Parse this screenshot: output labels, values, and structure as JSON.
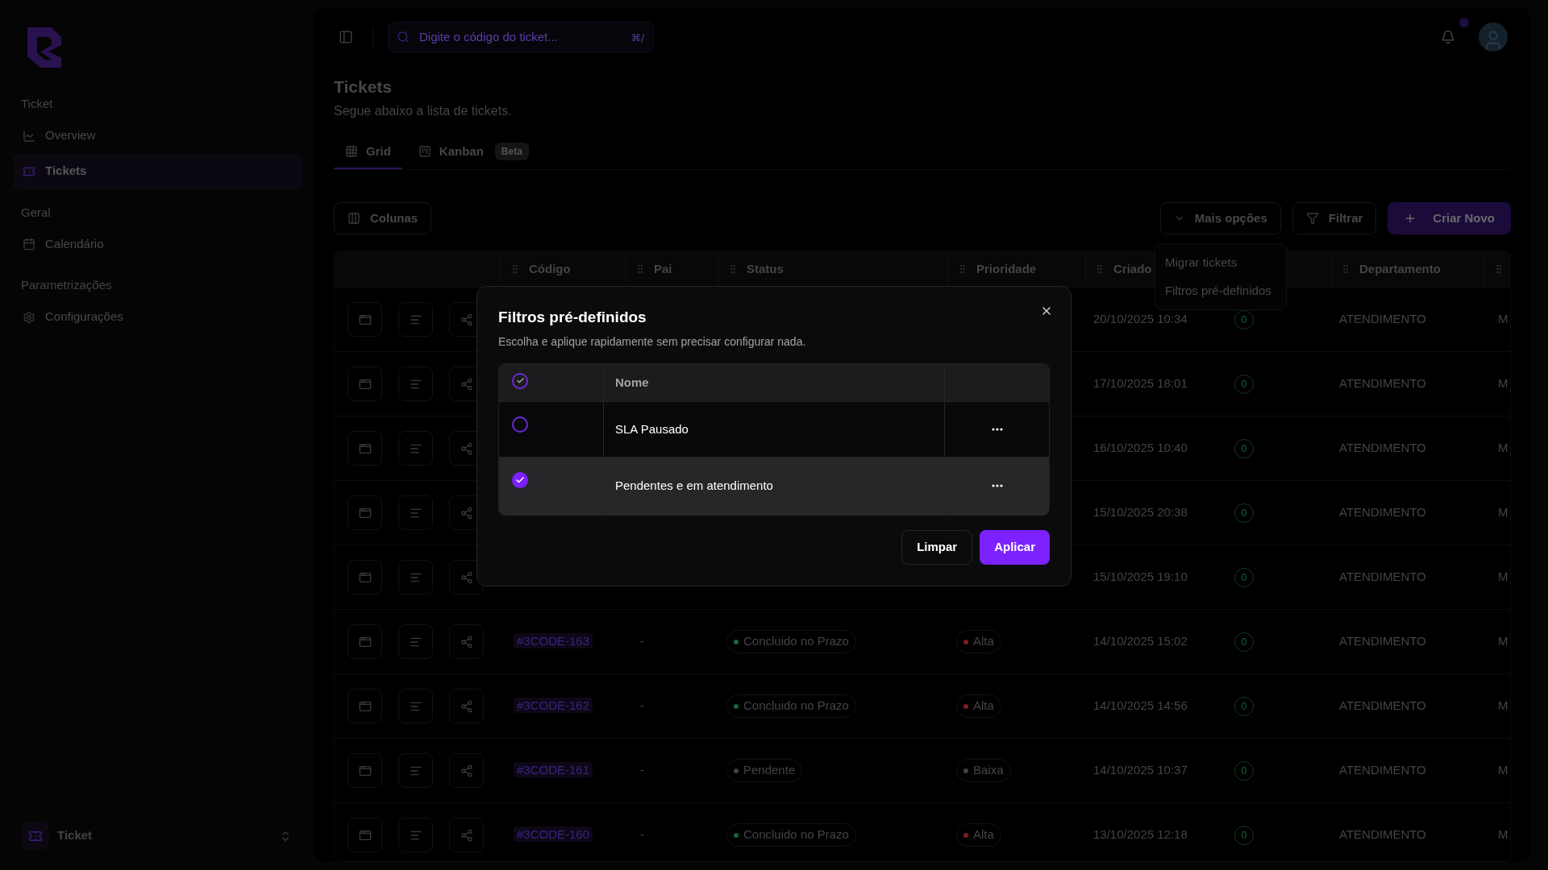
{
  "sidebar": {
    "sections": [
      {
        "title": "Ticket",
        "items": [
          {
            "label": "Overview",
            "selected": false
          },
          {
            "label": "Tickets",
            "selected": true
          }
        ]
      },
      {
        "title": "Geral",
        "items": [
          {
            "label": "Calendário",
            "selected": false
          }
        ]
      },
      {
        "title": "Parametrizações",
        "items": [
          {
            "label": "Configurações",
            "selected": false
          }
        ]
      }
    ],
    "workspace": {
      "name": "Ticket"
    }
  },
  "header": {
    "search": {
      "placeholder": "Digite o código do ticket...",
      "shortcut": "⌘/"
    }
  },
  "page": {
    "title": "Tickets",
    "subtitle": "Segue abaixo a lista de tickets."
  },
  "tabs": [
    {
      "label": "Grid",
      "selected": true
    },
    {
      "label": "Kanban",
      "badge": "Beta",
      "selected": false
    }
  ],
  "toolbar": {
    "columns_button": "Colunas",
    "more_button": "Mais opções",
    "filter_button": "Filtrar",
    "create_button": "Criar Novo"
  },
  "more_menu": [
    "Migrar tickets",
    "Filtros pré-definidos"
  ],
  "table": {
    "columns": [
      "Código",
      "Pai",
      "Status",
      "Prioridade",
      "Criado",
      "Departamento"
    ],
    "rows": [
      {
        "created": "20/10/2025 10:34",
        "count": "0",
        "department": "ATENDIMENTO",
        "column_9": "M"
      },
      {
        "created": "17/10/2025 18:01",
        "count": "0",
        "department": "ATENDIMENTO",
        "column_9": "M"
      },
      {
        "created": "16/10/2025 10:40",
        "count": "0",
        "department": "ATENDIMENTO",
        "column_9": "M"
      },
      {
        "created": "15/10/2025 20:38",
        "count": "0",
        "department": "ATENDIMENTO",
        "column_9": "M"
      },
      {
        "created": "15/10/2025 19:10",
        "count": "0",
        "department": "ATENDIMENTO",
        "column_9": "M"
      },
      {
        "code": "#3CODE-163",
        "parent": "-",
        "status": {
          "label": "Concluido no Prazo",
          "color": "#166534"
        },
        "priority": {
          "label": "Alta",
          "color": "#7f1d1d"
        },
        "created": "14/10/2025 15:02",
        "count": "0",
        "department": "ATENDIMENTO",
        "column_9": "M"
      },
      {
        "code": "#3CODE-162",
        "parent": "-",
        "status": {
          "label": "Concluido no Prazo",
          "color": "#166534"
        },
        "priority": {
          "label": "Alta",
          "color": "#7f1d1d"
        },
        "created": "14/10/2025 14:56",
        "count": "0",
        "department": "ATENDIMENTO",
        "column_9": "M"
      },
      {
        "code": "#3CODE-161",
        "parent": "-",
        "status": {
          "label": "Pendente",
          "color": "#404040"
        },
        "priority": {
          "label": "Baixa",
          "color": "#404040"
        },
        "created": "14/10/2025 10:37",
        "count": "0",
        "department": "ATENDIMENTO",
        "column_9": "M"
      },
      {
        "code": "#3CODE-160",
        "parent": "-",
        "status": {
          "label": "Concluido no Prazo",
          "color": "#166534"
        },
        "priority": {
          "label": "Alta",
          "color": "#7f1d1d"
        },
        "created": "13/10/2025 12:18",
        "count": "0",
        "department": "ATENDIMENTO",
        "column_9": "M"
      }
    ]
  },
  "modal": {
    "title": "Filtros pré-definidos",
    "subtitle": "Escolha e aplique rapidamente sem precisar configurar nada.",
    "header_checkbox": {
      "checked": true
    },
    "name_column": "Nome",
    "filters": [
      {
        "name": "SLA Pausado",
        "selected": false
      },
      {
        "name": "Pendentes e em atendimento",
        "selected": true
      }
    ],
    "buttons": {
      "clear": "Limpar",
      "apply": "Aplicar"
    }
  }
}
